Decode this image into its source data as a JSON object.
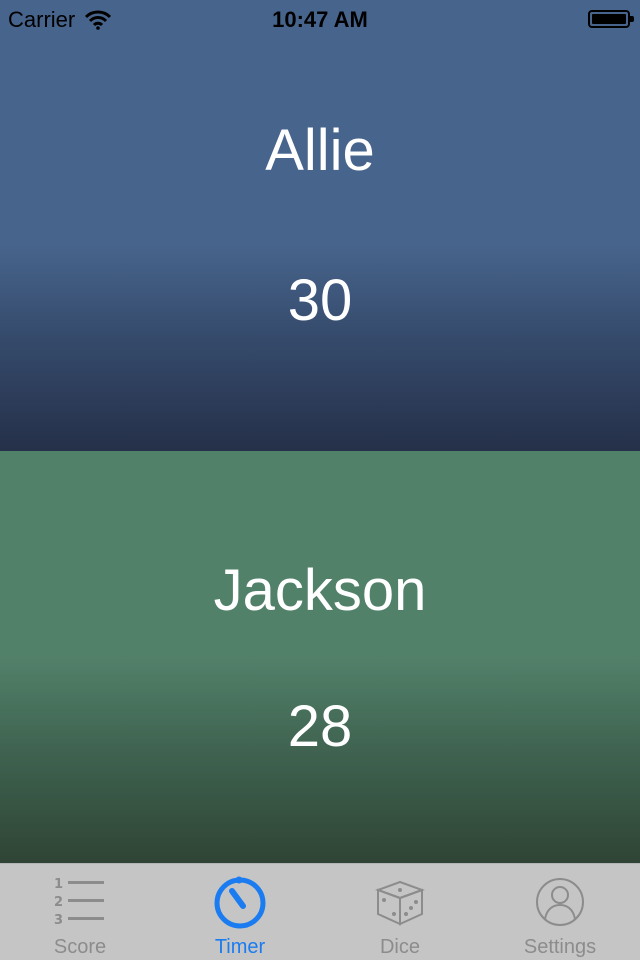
{
  "status_bar": {
    "carrier": "Carrier",
    "time": "10:47 AM",
    "battery_level": 1.0
  },
  "players": [
    {
      "name": "Allie",
      "score": "30",
      "color": "#47648c"
    },
    {
      "name": "Jackson",
      "score": "28",
      "color": "#52816a"
    }
  ],
  "tab_bar": {
    "active_tab": "Timer",
    "accent_color": "#1a7cf0",
    "tabs": [
      {
        "label": "Score",
        "icon": "numbered-list-icon"
      },
      {
        "label": "Timer",
        "icon": "stopwatch-icon"
      },
      {
        "label": "Dice",
        "icon": "dice-icon"
      },
      {
        "label": "Settings",
        "icon": "user-profile-icon"
      }
    ]
  }
}
